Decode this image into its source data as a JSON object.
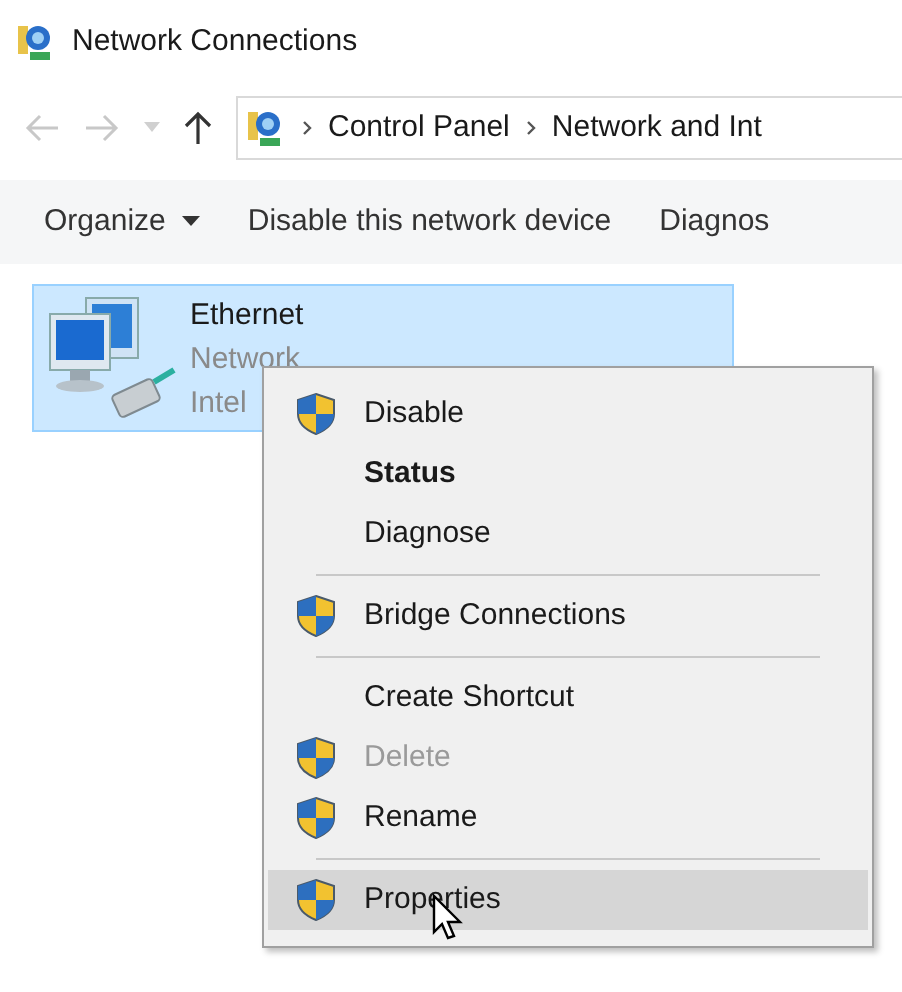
{
  "window": {
    "title": "Network Connections"
  },
  "address_bar": {
    "crumbs": [
      "Control Panel",
      "Network and Int"
    ]
  },
  "toolbar": {
    "items": [
      {
        "label": "Organize",
        "dropdown": true
      },
      {
        "label": "Disable this network device",
        "dropdown": false
      },
      {
        "label": "Diagnos",
        "dropdown": false
      }
    ]
  },
  "connections": [
    {
      "name": "Ethernet",
      "status": "Network",
      "device": "Intel",
      "selected": true
    }
  ],
  "context_menu": {
    "items": [
      {
        "kind": "item",
        "label": "Disable",
        "shield": true,
        "bold": false,
        "disabled": false,
        "selected": false
      },
      {
        "kind": "item",
        "label": "Status",
        "shield": false,
        "bold": true,
        "disabled": false,
        "selected": false
      },
      {
        "kind": "item",
        "label": "Diagnose",
        "shield": false,
        "bold": false,
        "disabled": false,
        "selected": false
      },
      {
        "kind": "separator"
      },
      {
        "kind": "item",
        "label": "Bridge Connections",
        "shield": true,
        "bold": false,
        "disabled": false,
        "selected": false
      },
      {
        "kind": "separator"
      },
      {
        "kind": "item",
        "label": "Create Shortcut",
        "shield": false,
        "bold": false,
        "disabled": false,
        "selected": false
      },
      {
        "kind": "item",
        "label": "Delete",
        "shield": true,
        "bold": false,
        "disabled": true,
        "selected": false
      },
      {
        "kind": "item",
        "label": "Rename",
        "shield": true,
        "bold": false,
        "disabled": false,
        "selected": false
      },
      {
        "kind": "separator"
      },
      {
        "kind": "item",
        "label": "Properties",
        "shield": true,
        "bold": false,
        "disabled": false,
        "selected": true
      }
    ]
  }
}
